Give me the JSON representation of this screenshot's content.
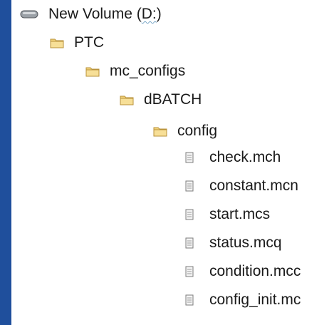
{
  "tree": {
    "drive": {
      "label_pre": "New Volume (",
      "label_mid": "D:",
      "label_post": ")",
      "icon": "drive-icon"
    },
    "folders": [
      {
        "label": "PTC",
        "icon": "folder-icon"
      },
      {
        "label": "mc_configs",
        "icon": "folder-icon"
      },
      {
        "label": "dBATCH",
        "icon": "folder-icon"
      },
      {
        "label": "config",
        "icon": "folder-icon"
      }
    ],
    "files": [
      {
        "label": "check.mch",
        "icon": "file-icon"
      },
      {
        "label": "constant.mcn",
        "icon": "file-icon"
      },
      {
        "label": "start.mcs",
        "icon": "file-icon"
      },
      {
        "label": "status.mcq",
        "icon": "file-icon"
      },
      {
        "label": "condition.mcc",
        "icon": "file-icon"
      },
      {
        "label": "config_init.mc",
        "icon": "file-icon"
      }
    ]
  },
  "colors": {
    "left_bar": "#1f4f9c",
    "folder_fill": "#f2d27a",
    "folder_stroke": "#b8923a"
  }
}
